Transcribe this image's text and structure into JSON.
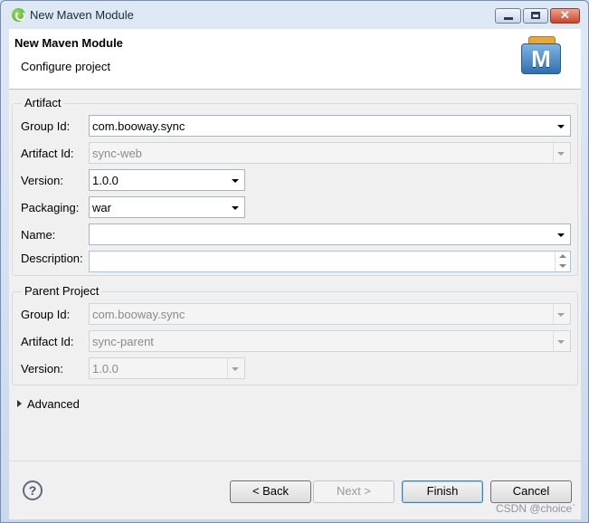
{
  "window": {
    "title": "New Maven Module"
  },
  "header": {
    "title": "New Maven Module",
    "subtitle": "Configure project",
    "icon_letter": "M"
  },
  "artifact": {
    "group_label": "Artifact",
    "group_id_label": "Group Id:",
    "group_id_value": "com.booway.sync",
    "artifact_id_label": "Artifact Id:",
    "artifact_id_value": "sync-web",
    "version_label": "Version:",
    "version_value": "1.0.0",
    "packaging_label": "Packaging:",
    "packaging_value": "war",
    "name_label": "Name:",
    "name_value": "",
    "description_label": "Description:",
    "description_value": ""
  },
  "parent": {
    "group_label": "Parent Project",
    "group_id_label": "Group Id:",
    "group_id_value": "com.booway.sync",
    "artifact_id_label": "Artifact Id:",
    "artifact_id_value": "sync-parent",
    "version_label": "Version:",
    "version_value": "1.0.0"
  },
  "advanced": {
    "label": "Advanced"
  },
  "buttons": {
    "help": "?",
    "back": "< Back",
    "next": "Next >",
    "finish": "Finish",
    "cancel": "Cancel"
  },
  "watermark": "CSDN @choice`",
  "icons": {
    "app": "spring-leaf-icon",
    "maven": "maven-m-icon",
    "help": "help-icon"
  }
}
